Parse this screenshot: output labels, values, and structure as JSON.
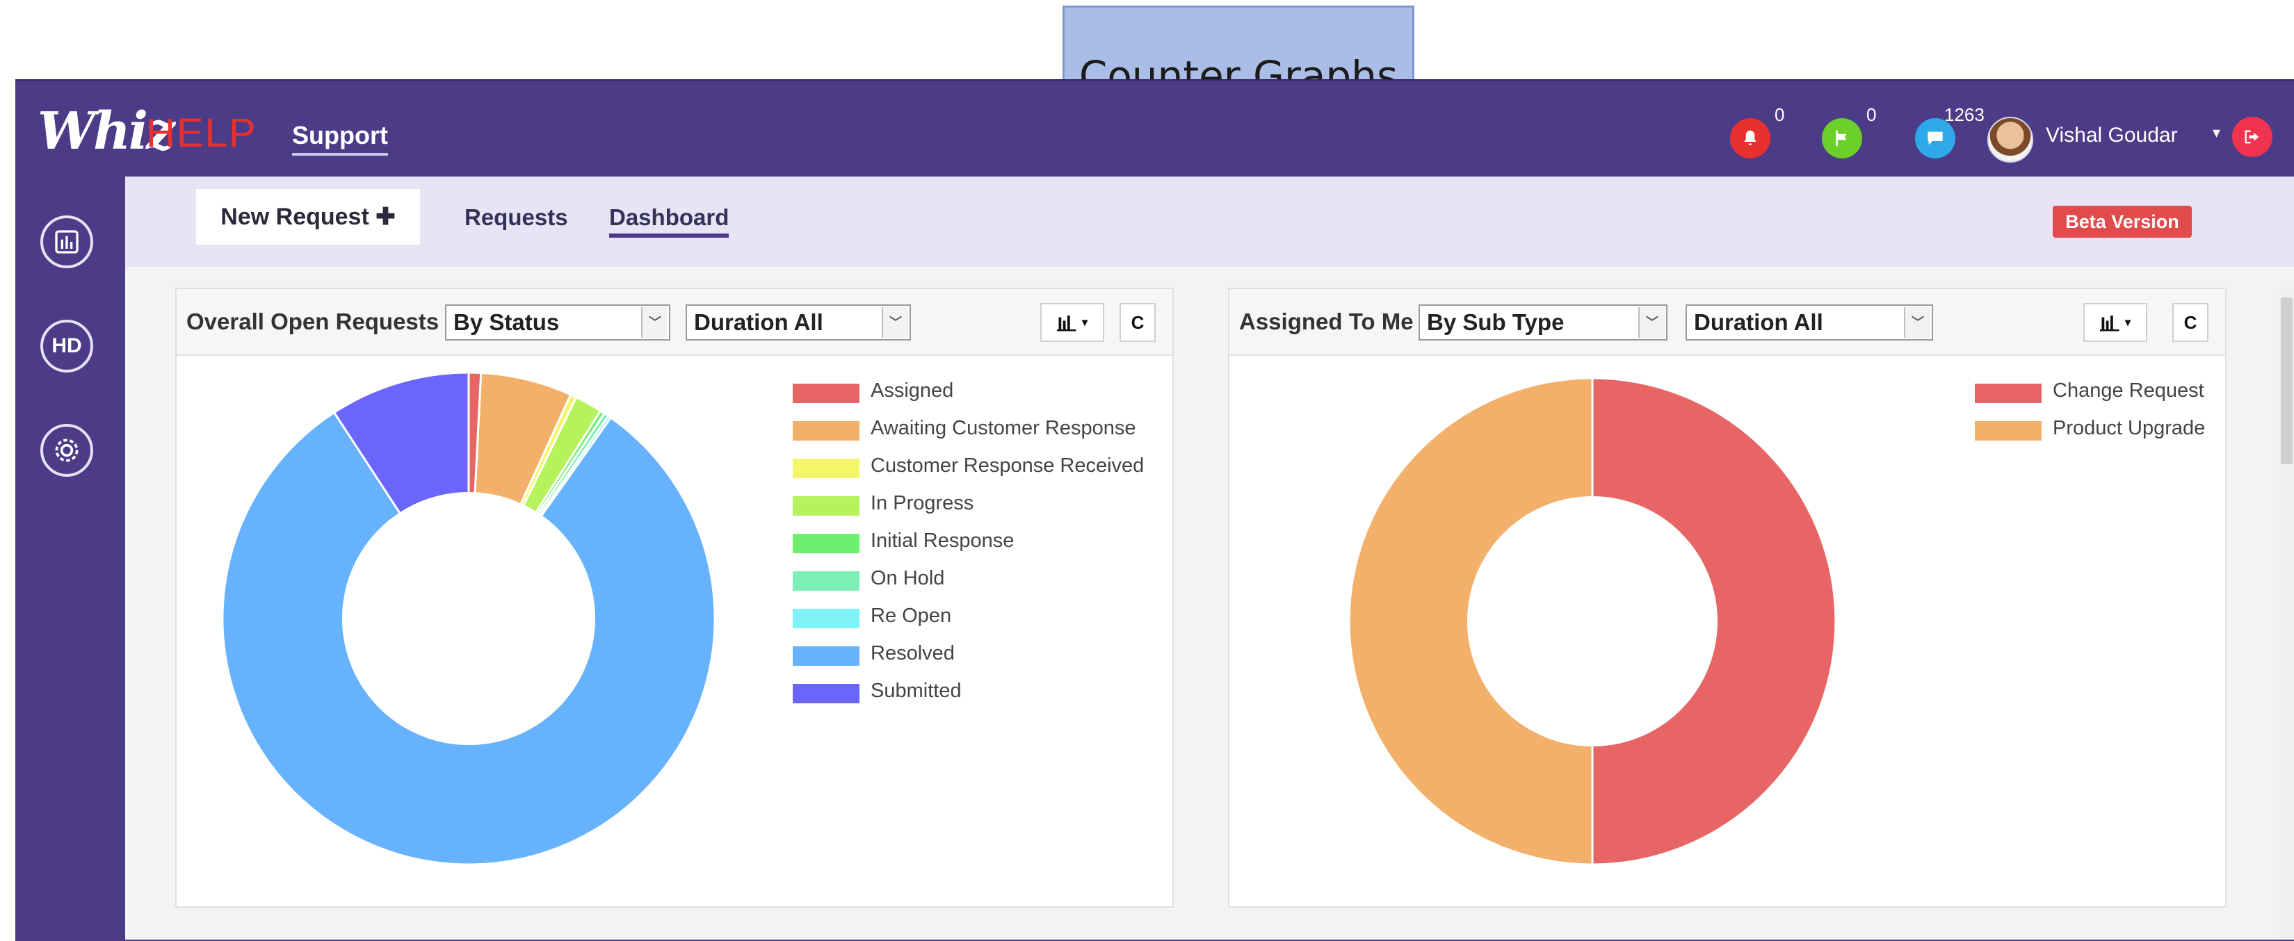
{
  "callout": {
    "text": "Counter Graphs"
  },
  "header": {
    "logo_whiz": "Whiz",
    "logo_help": "HELP",
    "app_name": "Support",
    "notifications": [
      {
        "icon": "bell-icon",
        "count": "0",
        "color": "#e8302f"
      },
      {
        "icon": "flag-icon",
        "count": "0",
        "color": "#6ccf2a"
      },
      {
        "icon": "chat-icon",
        "count": "1263",
        "color": "#2ea8e8"
      }
    ],
    "user_name": "Vishal Goudar",
    "user_caret": "▾",
    "logout_icon": "logout-icon"
  },
  "sidebar": {
    "items": [
      {
        "icon": "bar-chart-icon",
        "label": ""
      },
      {
        "icon": "helpdesk-icon",
        "label": "HD"
      },
      {
        "icon": "settings-icon",
        "label": ""
      }
    ]
  },
  "subnav": {
    "new_request": "New Request ✚",
    "requests": "Requests",
    "dashboard": "Dashboard",
    "beta": "Beta Version"
  },
  "panels": [
    {
      "title": "Overall Open Requests",
      "filter_1": "By Status",
      "filter_2": "Duration All",
      "chart_type_icon": "bar-chart-icon",
      "refresh_icon": "refresh-icon"
    },
    {
      "title": "Assigned To Me",
      "filter_1": "By Sub Type",
      "filter_2": "Duration All",
      "chart_type_icon": "bar-chart-icon",
      "refresh_icon": "refresh-icon"
    }
  ],
  "chart_data": [
    {
      "type": "pie",
      "donut": true,
      "legend_position": "right",
      "categories": [
        "Assigned",
        "Awaiting Customer Response",
        "Customer Response Received",
        "In Progress",
        "Initial Response",
        "On Hold",
        "Re Open",
        "Resolved",
        "Submitted"
      ],
      "values": [
        0.8,
        6.0,
        0.4,
        1.8,
        0.3,
        0.3,
        0.2,
        81.0,
        9.2
      ],
      "colors": [
        "#e86565",
        "#f2b06a",
        "#f5f56a",
        "#b6f25c",
        "#6ef06e",
        "#7ef0b6",
        "#7ef4f8",
        "#66b2fc",
        "#6a66fc"
      ]
    },
    {
      "type": "pie",
      "donut": true,
      "legend_position": "top-right",
      "categories": [
        "Change Request",
        "Product Upgrade"
      ],
      "values": [
        50,
        50
      ],
      "colors": [
        "#e86565",
        "#f2b06a"
      ]
    }
  ]
}
